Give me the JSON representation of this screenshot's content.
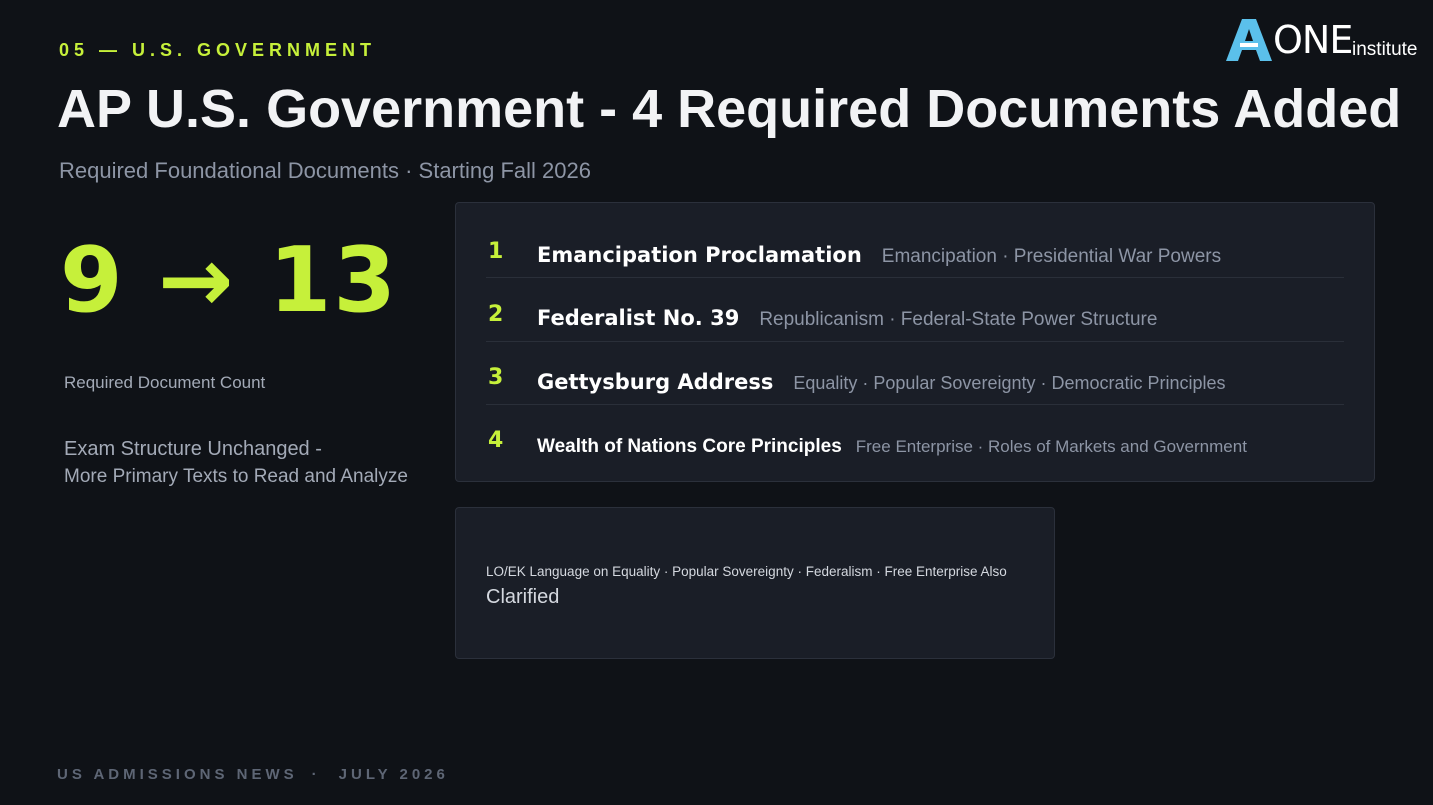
{
  "header": {
    "section_label": "05 — U.S. GOVERNMENT",
    "title": "AP U.S. Government - 4 Required Documents Added",
    "subtitle": "Required Foundational Documents · Starting Fall 2026"
  },
  "logo": {
    "letter_a": "A",
    "one": "ONE",
    "institute": "institute",
    "accent_color": "#5bc0eb"
  },
  "stats": {
    "document_count_change": "9 → 13",
    "count_label": "Required Document Count",
    "exam_note_line1": "Exam Structure Unchanged -",
    "exam_note_line2": "More Primary Texts to Read and Analyze"
  },
  "documents": [
    {
      "number": "1",
      "name": "Emancipation Proclamation",
      "topics": "Emancipation · Presidential War Powers"
    },
    {
      "number": "2",
      "name": "Federalist No. 39",
      "topics": "Republicanism · Federal-State Power Structure"
    },
    {
      "number": "3",
      "name": "Gettysburg Address",
      "topics": "Equality · Popular Sovereignty · Democratic Principles"
    },
    {
      "number": "4",
      "name": "Wealth of Nations Core Principles",
      "topics": "Free Enterprise · Roles of Markets and Government"
    }
  ],
  "note": {
    "line1": "LO/EK Language on Equality · Popular Sovereignty · Federalism · Free Enterprise Also",
    "line2": "Clarified"
  },
  "footer": {
    "source": "US ADMISSIONS NEWS",
    "separator": "·",
    "date": "JULY 2026"
  },
  "colors": {
    "background": "#0f1217",
    "accent": "#c6f03a",
    "card": "#1a1e27",
    "muted_text": "#8d95a5"
  }
}
